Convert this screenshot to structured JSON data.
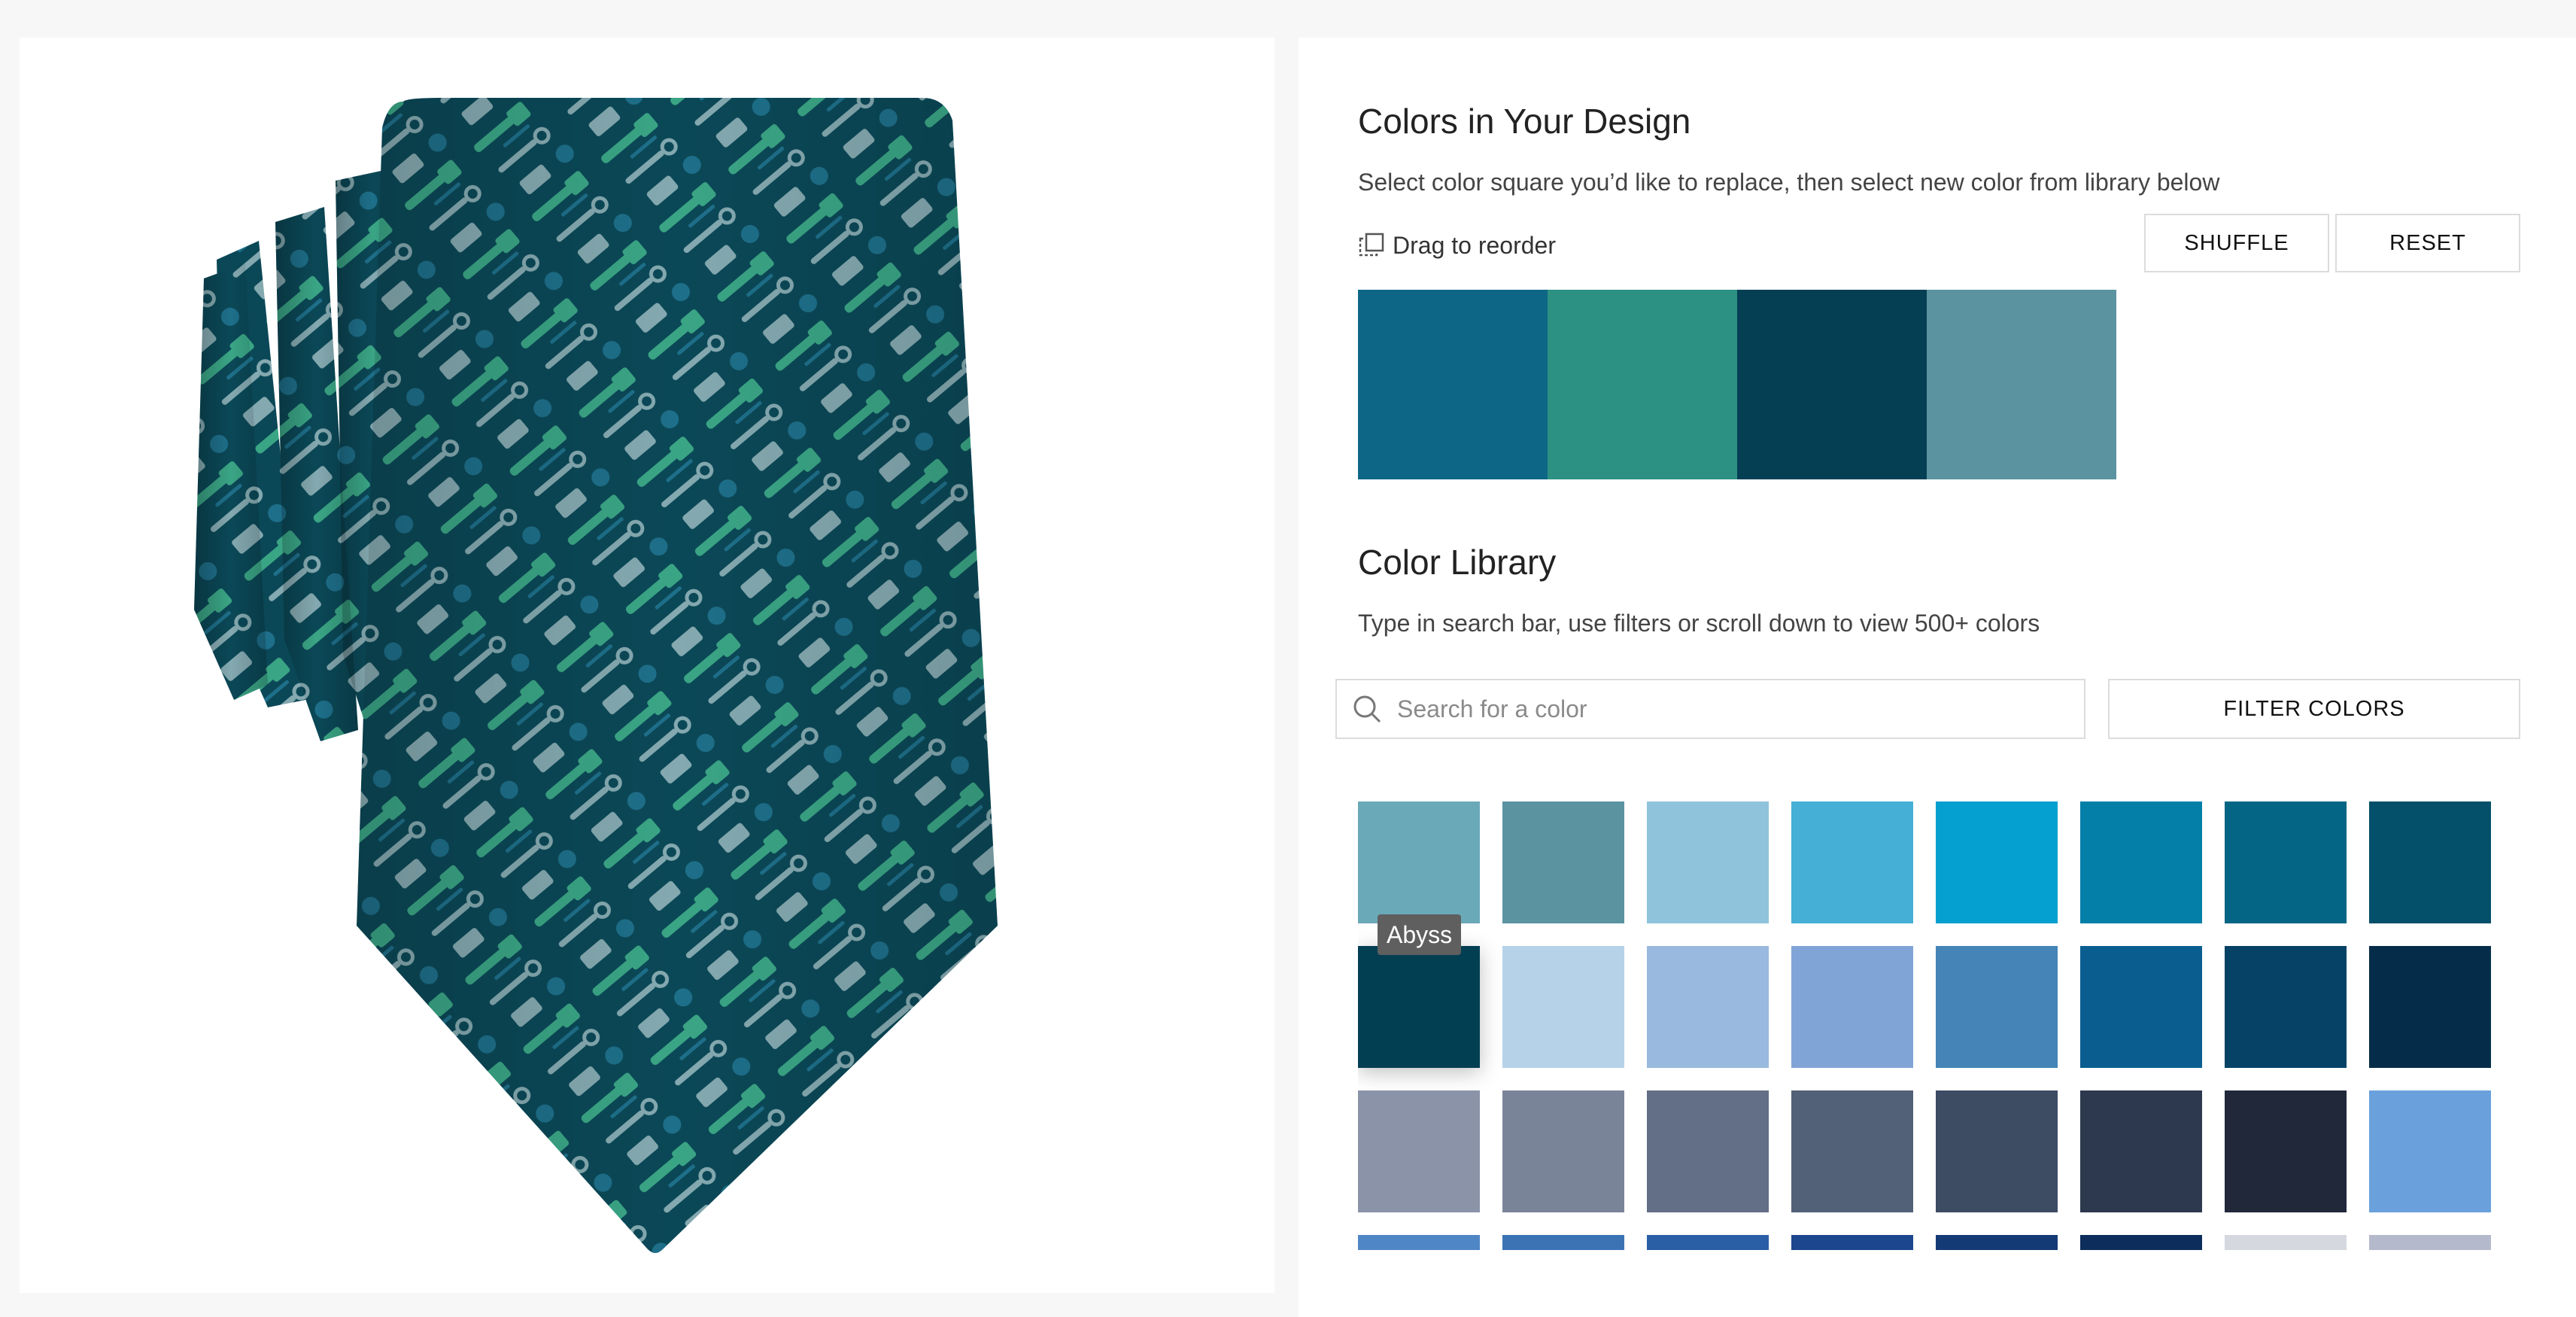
{
  "design": {
    "title": "Colors in Your Design",
    "instruction": "Select color square you’d like to replace, then select new color from library below",
    "drag_label": "Drag to reorder",
    "shuffle_label": "SHUFFLE",
    "reset_label": "RESET",
    "swatches": [
      "#0e6686",
      "#2c9182",
      "#043f54",
      "#5c93a0"
    ]
  },
  "library": {
    "title": "Color Library",
    "instruction": "Type in search bar, use filters or scroll down to view 500+ colors",
    "search_placeholder": "Search for a color",
    "filter_label": "FILTER COLORS",
    "hover_tooltip": "Abyss",
    "rows": [
      [
        "#6aa9b8",
        "#5b93a0",
        "#8fc3dc",
        "#45afd5",
        "#05a0cf",
        "#0480a8",
        "#056585",
        "#04506a"
      ],
      [
        "#033f53",
        "#b6d2e8",
        "#99b9de",
        "#80a4d6",
        "#4484b6",
        "#0a5e8f",
        "#064266",
        "#052d4a"
      ],
      [
        "#8a93a8",
        "#7a8499",
        "#636f87",
        "#526078",
        "#3d4b63",
        "#2d394e",
        "#20283a",
        "#6aa1dc"
      ],
      [
        "#4f86c6",
        "#3b73b5",
        "#2a5fa6",
        "#1c468d",
        "#143a76",
        "#0d2d5c",
        "#d6d8e0",
        "#b5b9cc"
      ]
    ]
  },
  "colors": {
    "tie_base": "#0b4857",
    "tie_motif_green": "#3aa585",
    "tie_motif_gray": "#84a9b0",
    "tie_motif_blue": "#1e6f8a"
  },
  "icons": {
    "drag": "drag-reorder-icon",
    "search": "search-icon"
  }
}
